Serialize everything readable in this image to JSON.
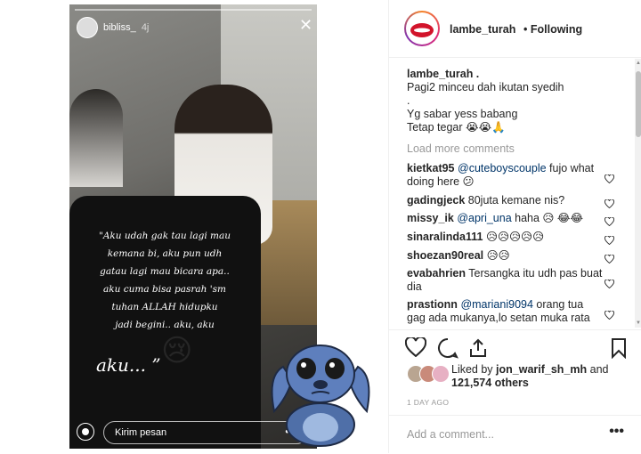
{
  "story": {
    "username": "bibliss_",
    "time": "4j",
    "quote_lines": [
      "\"Aku udah gak tau lagi mau",
      "kemana bi, aku pun udh",
      "gatau lagi mau bicara apa..",
      "aku cuma bisa pasrah 'sm",
      "tuhan ALLAH hidupku",
      "jadi begini.. aku, aku",
      "aku...  ”"
    ],
    "emoji": "😢",
    "reply_placeholder": "Kirim pesan"
  },
  "post": {
    "username": "lambe_turah",
    "following": "• Following",
    "caption": {
      "author": "lambe_turah .",
      "lines": [
        "Pagi2 minceu dah ikutan syedih",
        ".",
        "Yg sabar yess babang",
        "Tetap tegar 😭😭🙏"
      ]
    },
    "load_more": "Load more comments",
    "comments": [
      {
        "user": "kietkat95",
        "mention": "@cuteboyscouple",
        "text": " fujo what doing here 😕"
      },
      {
        "user": "gadingjeck",
        "mention": "",
        "text": " 80juta kemane nis?"
      },
      {
        "user": "missy_ik",
        "mention": "@apri_una",
        "text": " haha 😥 😂😂"
      },
      {
        "user": "sinaralinda111",
        "mention": "",
        "text": " 😥😥😥😥😥"
      },
      {
        "user": "shoezan90real",
        "mention": "",
        "text": " 😥😥"
      },
      {
        "user": "evabahrien",
        "mention": "",
        "text": " Tersangka itu udh pas buat dia"
      },
      {
        "user": "prastionn",
        "mention": "@mariani9094",
        "text": " orang tua gag ada mukanya,lo setan muka rata"
      }
    ],
    "likes_prefix": "Liked by ",
    "likes_user": "jon_warif_sh_mh",
    "likes_and": " and",
    "likes_count": "121,574 others",
    "time_ago": "1 DAY AGO",
    "add_comment": "Add a comment...",
    "more": "•••"
  }
}
